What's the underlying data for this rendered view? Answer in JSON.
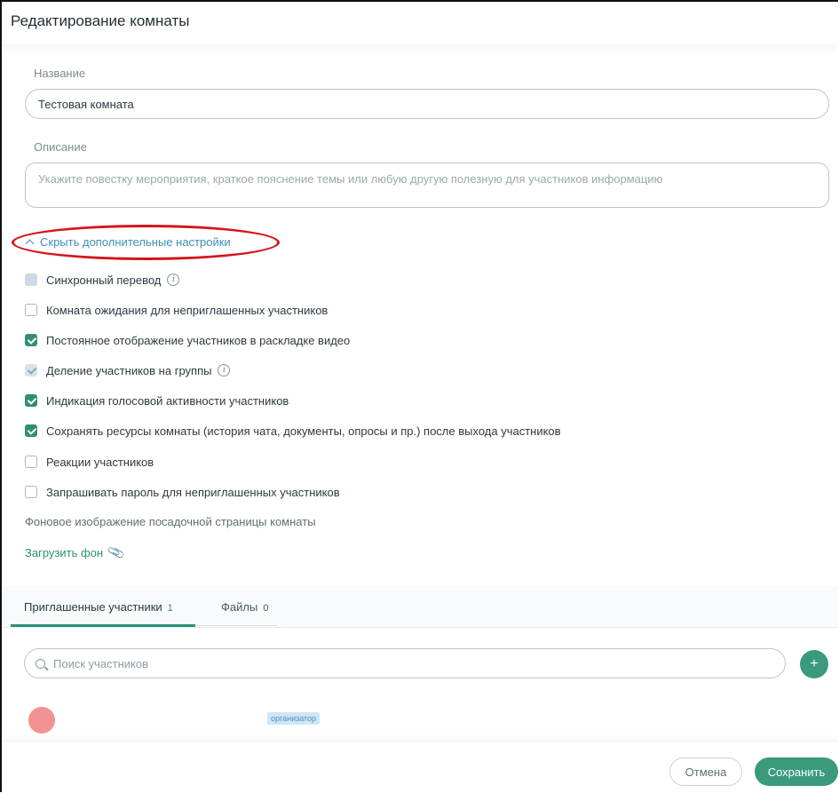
{
  "header": {
    "title": "Редактирование комнаты"
  },
  "form": {
    "name_label": "Название",
    "name_value": "Тестовая комната",
    "description_label": "Описание",
    "description_placeholder": "Укажите повестку мероприятия, краткое пояснение темы или любую другую полезную для участников информацию",
    "toggle_settings_label": "Скрыть дополнительные настройки",
    "options": [
      {
        "label": "Синхронный перевод",
        "state": "disabled",
        "info": true
      },
      {
        "label": "Комната ожидания для неприглашенных участников",
        "state": "unchecked",
        "info": false
      },
      {
        "label": "Постоянное отображение участников в раскладке видео",
        "state": "checked",
        "info": false
      },
      {
        "label": "Деление участников на группы",
        "state": "disabled-checked",
        "info": true
      },
      {
        "label": "Индикация голосовой активности участников",
        "state": "checked",
        "info": false
      },
      {
        "label": "Сохранять ресурсы комнаты (история чата, документы, опросы и пр.) после выхода участников",
        "state": "checked",
        "info": false
      },
      {
        "label": "Реакции участников",
        "state": "unchecked",
        "info": false
      },
      {
        "label": "Запрашивать пароль для неприглашенных участников",
        "state": "unchecked",
        "info": false
      }
    ],
    "background_label": "Фоновое изображение посадочной страницы комнаты",
    "upload_label": "Загрузить фон"
  },
  "tabs": [
    {
      "label": "Приглашенные участники",
      "count": "1",
      "active": true
    },
    {
      "label": "Файлы",
      "count": "0",
      "active": false
    }
  ],
  "participants": {
    "search_placeholder": "Поиск участников",
    "add_label": "+",
    "items": [
      {
        "role_badge": "организатор",
        "avatar_color": "#f39292"
      }
    ]
  },
  "footer": {
    "cancel_label": "Отмена",
    "save_label": "Сохранить"
  },
  "colors": {
    "accent": "#3a9a7c",
    "link": "#3d8fb8",
    "annotation": "#d4141c"
  }
}
